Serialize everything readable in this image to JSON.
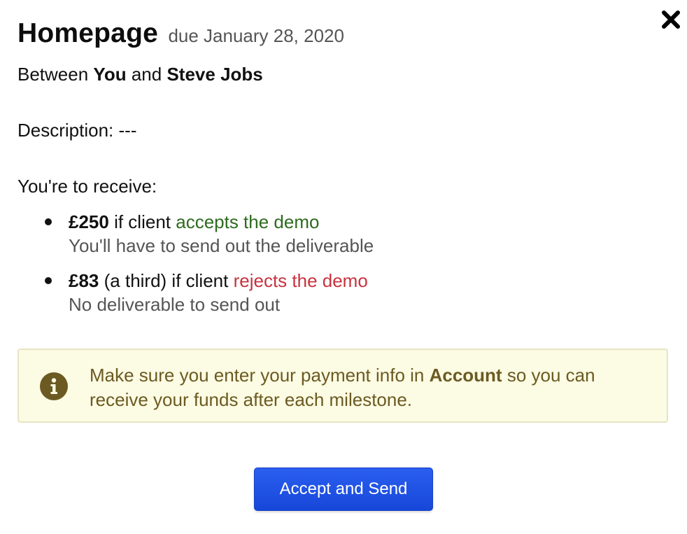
{
  "modal": {
    "title": "Homepage",
    "due_text": "due January 28, 2020",
    "between": {
      "prefix": "Between",
      "party_a": "You",
      "joiner": "and",
      "party_b": "Steve Jobs"
    },
    "description": "Description: ---",
    "receive_heading": "You're to receive:",
    "terms": [
      {
        "amount": "£250",
        "middle": "if client",
        "outcome": "accepts the demo",
        "outcome_color": "#2e6b1f",
        "note": "You'll have to send out the deliverable"
      },
      {
        "amount": "£83",
        "middle": "(a third) if client",
        "outcome": "rejects the demo",
        "outcome_color": "#c8323f",
        "note": "No deliverable to send out"
      }
    ],
    "notice": {
      "icon": "info-icon",
      "text_before": "Make sure you enter your payment info in",
      "link_text": "Account",
      "text_after": "so you can receive your funds after each milestone.",
      "background": "#fcfbe3",
      "text_color": "#6b5a22"
    },
    "primary_button_label": "Accept and Send",
    "close_icon": "close-icon",
    "accent_color": "#1a52e8"
  }
}
